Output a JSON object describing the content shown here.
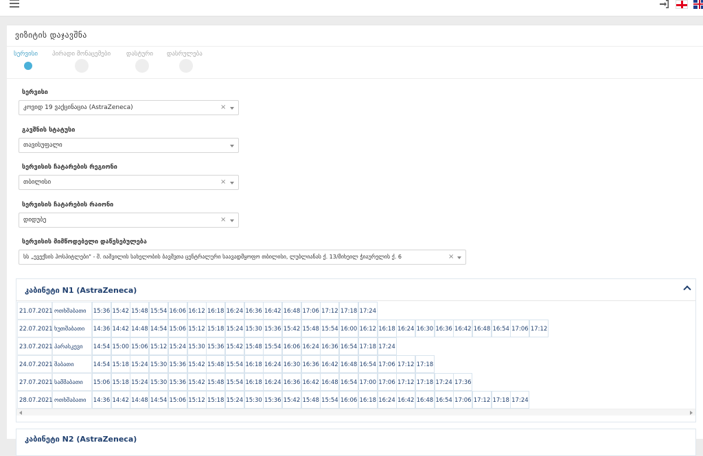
{
  "header": {
    "icons": [
      "hamburger-icon",
      "login-icon",
      "flag-georgia-icon",
      "flag-uk-icon"
    ]
  },
  "page": {
    "title": "ვიზიტის დაჯავშნა"
  },
  "steps": [
    {
      "label": "სერვისი",
      "active": true
    },
    {
      "label": "პირადი მონაცემები",
      "active": false
    },
    {
      "label": "დასტური",
      "active": false
    },
    {
      "label": "დასრულება",
      "active": false
    }
  ],
  "form": {
    "service": {
      "label": "სერვისი",
      "value": "კოვიდ 19 ვაქცინაცია (AstraZeneca)"
    },
    "status": {
      "label": "გავშნის სტატუსი",
      "value": "თავისუფალი"
    },
    "region": {
      "label": "სერვისის ჩატარების რეგიონი",
      "value": "თბილისი"
    },
    "district": {
      "label": "სერვისის ჩატარების რაიონი",
      "value": "დიდუბე"
    },
    "provider": {
      "label": "სერვისის მიმწოდებელი დაწესებულება",
      "value": "სს „ევექსის ჰოსპიტლები\" - შ. იაშვილის სახელობის ბავშვთა ცენტრალური საავადმყოფო თბილისი, ლუბლიანას ქ. 13/მიხეილ ჭიაურელის ქ. 6"
    }
  },
  "cabinets": [
    {
      "title": "კაბინეტი N1 (AstraZeneca)",
      "days": [
        {
          "date": "21.07.2021",
          "day": "ოთხშაბათი",
          "slots": [
            "15:36",
            "15:42",
            "15:48",
            "15:54",
            "16:06",
            "16:12",
            "16:18",
            "16:24",
            "16:36",
            "16:42",
            "16:48",
            "17:06",
            "17:12",
            "17:18",
            "17:24"
          ]
        },
        {
          "date": "22.07.2021",
          "day": "ხუთშაბათი",
          "slots": [
            "14:36",
            "14:42",
            "14:48",
            "14:54",
            "15:06",
            "15:12",
            "15:18",
            "15:24",
            "15:30",
            "15:36",
            "15:42",
            "15:48",
            "15:54",
            "16:00",
            "16:12",
            "16:18",
            "16:24",
            "16:30",
            "16:36",
            "16:42",
            "16:48",
            "16:54",
            "17:06",
            "17:12"
          ]
        },
        {
          "date": "23.07.2021",
          "day": "პარასკევი",
          "slots": [
            "14:54",
            "15:00",
            "15:06",
            "15:12",
            "15:24",
            "15:30",
            "15:36",
            "15:42",
            "15:48",
            "15:54",
            "16:06",
            "16:24",
            "16:36",
            "16:54",
            "17:18",
            "17:24"
          ]
        },
        {
          "date": "24.07.2021",
          "day": "შაბათი",
          "slots": [
            "14:54",
            "15:18",
            "15:24",
            "15:30",
            "15:36",
            "15:42",
            "15:48",
            "15:54",
            "16:18",
            "16:24",
            "16:30",
            "16:36",
            "16:42",
            "16:48",
            "16:54",
            "17:06",
            "17:12",
            "17:18"
          ]
        },
        {
          "date": "27.07.2021",
          "day": "სამშაბათი",
          "slots": [
            "15:06",
            "15:18",
            "15:24",
            "15:30",
            "15:36",
            "15:42",
            "15:48",
            "15:54",
            "16:18",
            "16:24",
            "16:36",
            "16:42",
            "16:48",
            "16:54",
            "17:00",
            "17:06",
            "17:12",
            "17:18",
            "17:24",
            "17:36"
          ]
        },
        {
          "date": "28.07.2021",
          "day": "ოთხშაბათი",
          "slots": [
            "14:36",
            "14:42",
            "14:48",
            "14:54",
            "15:06",
            "15:12",
            "15:18",
            "15:24",
            "15:30",
            "15:36",
            "15:42",
            "15:48",
            "15:54",
            "16:06",
            "16:18",
            "16:24",
            "16:42",
            "16:48",
            "16:54",
            "17:06",
            "17:12",
            "17:18",
            "17:24"
          ]
        }
      ]
    },
    {
      "title": "კაბინეტი N2 (AstraZeneca)",
      "days": []
    }
  ]
}
